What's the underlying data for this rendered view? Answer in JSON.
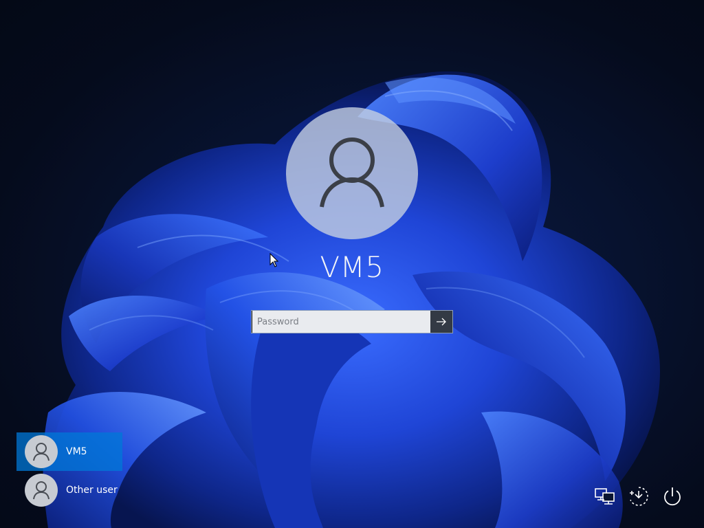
{
  "login": {
    "username": "VM5",
    "password_placeholder": "Password"
  },
  "user_list": [
    {
      "name": "VM5",
      "selected": true
    },
    {
      "name": "Other user",
      "selected": false
    }
  ],
  "system_icons": [
    "network-icon",
    "accessibility-icon",
    "power-icon"
  ],
  "colors": {
    "background": "#050b1c",
    "bloom": "#1a3fd8",
    "selected_user": "#0078d7",
    "avatar": "#c8d2e1"
  }
}
